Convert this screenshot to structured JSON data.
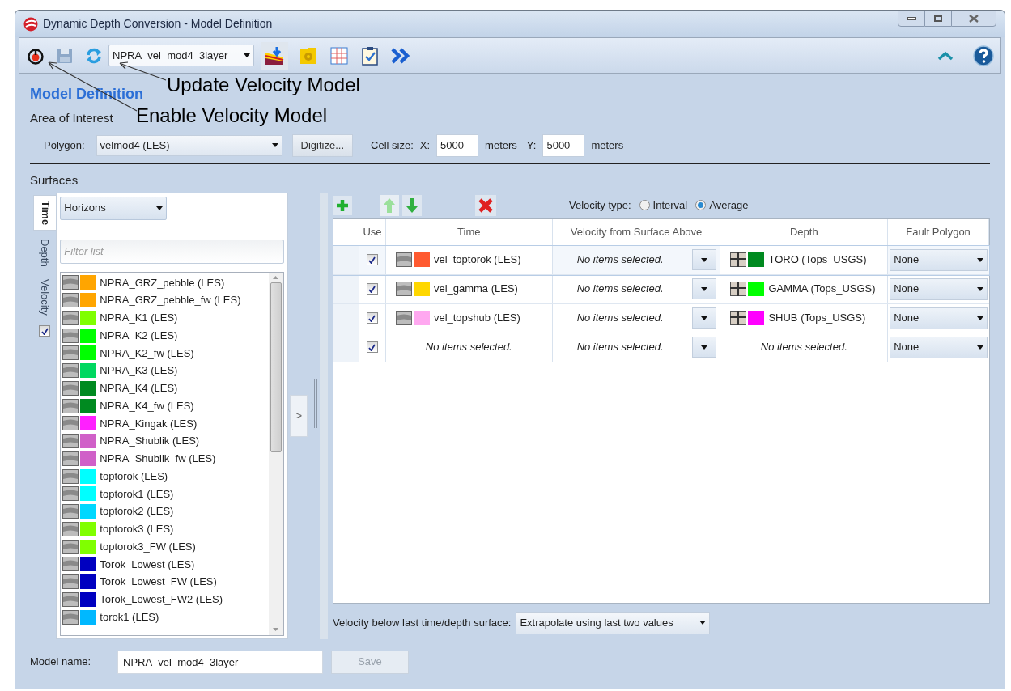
{
  "window": {
    "title": "Dynamic Depth Conversion - Model Definition"
  },
  "toolbar": {
    "model_select": "NPRA_vel_mod4_3layer"
  },
  "annotations": [
    {
      "text": "Update Velocity Model"
    },
    {
      "text": "Enable Velocity Model"
    }
  ],
  "heading": "Model Definition",
  "area_of_interest": {
    "label": "Area of Interest",
    "polygon_label": "Polygon:",
    "polygon_value": "velmod4 (LES)",
    "digitize_button": "Digitize...",
    "cell_size_label": "Cell size:",
    "x_label": "X:",
    "x_value": "5000",
    "x_unit": "meters",
    "y_label": "Y:",
    "y_value": "5000",
    "y_unit": "meters"
  },
  "surfaces": {
    "label": "Surfaces",
    "side_tabs": [
      {
        "label": "Time",
        "selected": true
      },
      {
        "label": "Depth",
        "selected": false
      },
      {
        "label": "Velocity",
        "selected": false
      }
    ],
    "velocity_checkbox": {
      "checked": true
    },
    "category_select": "Horizons",
    "filter": {
      "placeholder": "Filter list"
    },
    "items": [
      {
        "label": "NPRA_GRZ_pebble (LES)",
        "color": "#ffa500"
      },
      {
        "label": "NPRA_GRZ_pebble_fw (LES)",
        "color": "#ffa500"
      },
      {
        "label": "NPRA_K1 (LES)",
        "color": "#80ff00"
      },
      {
        "label": "NPRA_K2 (LES)",
        "color": "#00ff00"
      },
      {
        "label": "NPRA_K2_fw (LES)",
        "color": "#00ff00"
      },
      {
        "label": "NPRA_K3 (LES)",
        "color": "#00d860"
      },
      {
        "label": "NPRA_K4 (LES)",
        "color": "#008a20"
      },
      {
        "label": "NPRA_K4_fw (LES)",
        "color": "#008a20"
      },
      {
        "label": "NPRA_Kingak (LES)",
        "color": "#ff20ff"
      },
      {
        "label": "NPRA_Shublik (LES)",
        "color": "#d060c8"
      },
      {
        "label": "NPRA_Shublik_fw (LES)",
        "color": "#d060c8"
      },
      {
        "label": "toptorok (LES)",
        "color": "#00ffff"
      },
      {
        "label": "toptorok1 (LES)",
        "color": "#00ffff"
      },
      {
        "label": "toptorok2 (LES)",
        "color": "#00d8ff"
      },
      {
        "label": "toptorok3 (LES)",
        "color": "#80ff00"
      },
      {
        "label": "toptorok3_FW (LES)",
        "color": "#80ff00"
      },
      {
        "label": "Torok_Lowest (LES)",
        "color": "#0000c0"
      },
      {
        "label": "Torok_Lowest_FW (LES)",
        "color": "#0000c0"
      },
      {
        "label": "Torok_Lowest_FW2 (LES)",
        "color": "#0000c0"
      },
      {
        "label": "torok1 (LES)",
        "color": "#00b8ff"
      }
    ],
    "move_button": ">"
  },
  "model_table": {
    "velocity_type_label": "Velocity type:",
    "velocity_types": [
      {
        "label": "Interval",
        "selected": false
      },
      {
        "label": "Average",
        "selected": true
      }
    ],
    "columns": [
      "Use",
      "Time",
      "Velocity from Surface Above",
      "Depth",
      "Fault Polygon"
    ],
    "rows": [
      {
        "selected": true,
        "use": true,
        "time": {
          "kind": "surface",
          "text": "vel_toptorok (LES)",
          "color": "#ff5a30"
        },
        "velocity": "No items selected.",
        "depth": {
          "kind": "surface",
          "text": "TORO (Tops_USGS)",
          "color": "#008a20"
        },
        "fault": "None"
      },
      {
        "selected": false,
        "use": true,
        "time": {
          "kind": "surface",
          "text": "vel_gamma (LES)",
          "color": "#ffd700"
        },
        "velocity": "No items selected.",
        "depth": {
          "kind": "surface",
          "text": "GAMMA (Tops_USGS)",
          "color": "#00ff00"
        },
        "fault": "None"
      },
      {
        "selected": false,
        "use": true,
        "time": {
          "kind": "surface",
          "text": "vel_topshub (LES)",
          "color": "#ffa8f0"
        },
        "velocity": "No items selected.",
        "depth": {
          "kind": "surface",
          "text": "SHUB (Tops_USGS)",
          "color": "#ff00ff"
        },
        "fault": "None"
      },
      {
        "selected": false,
        "use": true,
        "time": {
          "kind": "empty",
          "text": "No items selected."
        },
        "velocity": "No items selected.",
        "depth": {
          "kind": "empty",
          "text": "No items selected."
        },
        "fault": "None"
      }
    ],
    "below_label": "Velocity below last time/depth surface:",
    "below_value": "Extrapolate using last two values"
  },
  "footer": {
    "model_name_label": "Model name:",
    "model_name_value": "NPRA_vel_mod4_3layer",
    "save_button": {
      "label": "Save",
      "disabled": true
    }
  }
}
